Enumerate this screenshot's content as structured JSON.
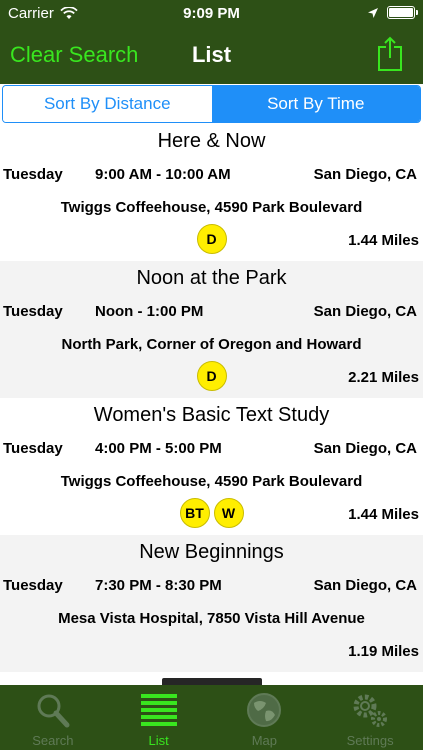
{
  "status": {
    "carrier": "Carrier",
    "time": "9:09 PM"
  },
  "nav": {
    "clear_label": "Clear Search",
    "title": "List"
  },
  "segments": {
    "left": "Sort By Distance",
    "right": "Sort By Time"
  },
  "meetings": [
    {
      "name": "Here & Now",
      "day": "Tuesday",
      "hours": "9:00 AM - 10:00 AM",
      "city": "San Diego, CA",
      "address": "Twiggs Coffeehouse, 4590 Park Boulevard",
      "badges": [
        "D"
      ],
      "distance": "1.44 Miles"
    },
    {
      "name": "Noon at the Park",
      "day": "Tuesday",
      "hours": "Noon - 1:00 PM",
      "city": "San Diego, CA",
      "address": "North Park, Corner of Oregon and Howard",
      "badges": [
        "D"
      ],
      "distance": "2.21 Miles"
    },
    {
      "name": "Women's Basic Text Study",
      "day": "Tuesday",
      "hours": "4:00 PM - 5:00 PM",
      "city": "San Diego, CA",
      "address": "Twiggs Coffeehouse, 4590 Park Boulevard",
      "badges": [
        "BT",
        "W"
      ],
      "distance": "1.44 Miles"
    },
    {
      "name": "New Beginnings",
      "day": "Tuesday",
      "hours": "7:30 PM - 8:30 PM",
      "city": "San Diego, CA",
      "address": "Mesa Vista Hospital, 7850 Vista Hill Avenue",
      "badges": [],
      "distance": "1.19 Miles"
    }
  ],
  "tabs": [
    {
      "label": "Search",
      "icon": "magnifier-icon",
      "active": false
    },
    {
      "label": "List",
      "icon": "list-icon",
      "active": true
    },
    {
      "label": "Map",
      "icon": "globe-icon",
      "active": false
    },
    {
      "label": "Settings",
      "icon": "gears-icon",
      "active": false
    }
  ],
  "colors": {
    "bar": "#2d5016",
    "accent_green": "#39e61f",
    "segment_blue": "#1f8ff8",
    "badge_yellow": "#ffee00",
    "alt_row": "#f3f3f3"
  }
}
